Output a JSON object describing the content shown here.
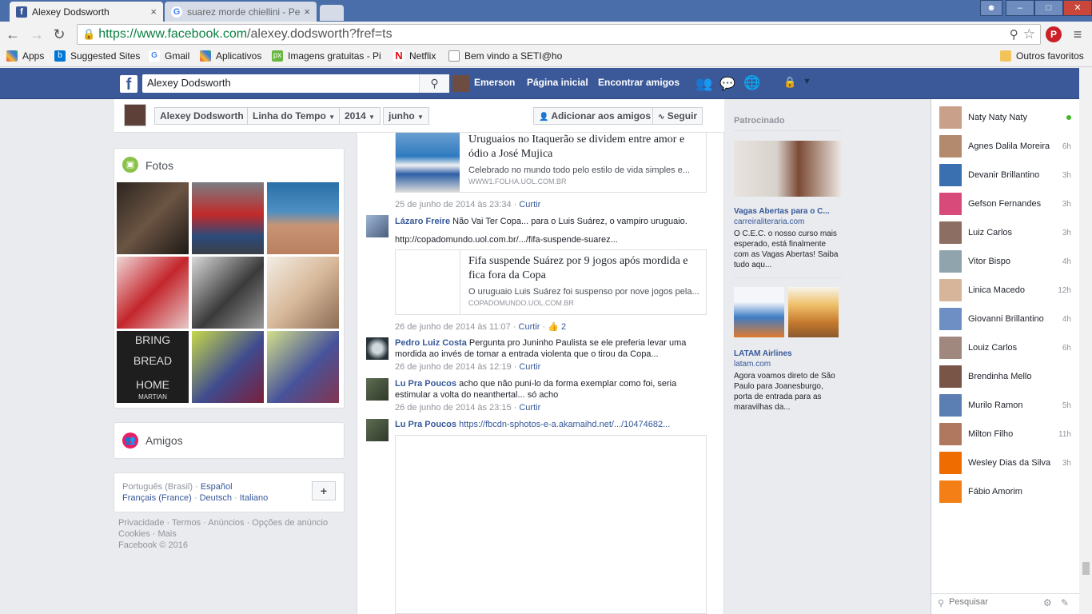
{
  "browser": {
    "tabs": [
      {
        "title": "Alexey Dodsworth",
        "close": "×"
      },
      {
        "title": "suarez morde chiellini - Pe",
        "close": "×"
      }
    ],
    "url": "https://www.facebook.com/alexey.dodsworth?fref=ts",
    "url_host": "https://www.facebook.com",
    "url_path": "/alexey.dodsworth?fref=ts",
    "bookmarks": [
      "Apps",
      "Suggested Sites",
      "Gmail",
      "Aplicativos",
      "Imagens gratuitas - Pi",
      "Netflix",
      "Bem vindo a SETI@ho",
      "Outros favoritos"
    ]
  },
  "fb": {
    "search_value": "Alexey Dodsworth",
    "user": "Emerson",
    "nav": [
      "Página inicial",
      "Encontrar amigos"
    ]
  },
  "timeline": {
    "name": "Alexey Dodsworth",
    "section": "Linha do Tempo",
    "year": "2014",
    "month": "junho",
    "add_friend": "Adicionar aos amigos",
    "follow": "Seguir"
  },
  "left": {
    "photos_title": "Fotos",
    "photo_captions": [
      "BRING",
      "BREAD",
      "HOME",
      "MARTIAN"
    ],
    "friends_title": "Amigos",
    "langs": {
      "current": "Português (Brasil)",
      "sep": "·",
      "l1": "Español",
      "l2": "Français (France)",
      "l3": "Deutsch",
      "l4": "Italiano",
      "add": "+"
    },
    "footer": {
      "line1": "Privacidade · Termos · Anúncios · Opções de anúncio",
      "line2": "Cookies · Mais",
      "line3": "Facebook © 2016"
    }
  },
  "feed": {
    "article1": {
      "title": "Uruguaios no Itaquerão se dividem entre amor e ódio a José Mujica",
      "desc": "Celebrado no mundo todo pelo estilo de vida simples e...",
      "source": "WWW1.FOLHA.UOL.COM.BR"
    },
    "meta1": "25 de junho de 2014 às 23:34 · ",
    "curtir": "Curtir",
    "c1": {
      "name": "Lázaro Freire",
      "text": "Não Vai Ter Copa... para o Luis Suárez, o vampiro uruguaio.",
      "link": "http://copadomundo.uol.com.br/.../fifa-suspende-suarez..."
    },
    "article2": {
      "title": "Fifa suspende Suárez por 9 jogos após mordida e fica fora da Copa",
      "desc": "O uruguaio Luis Suárez foi suspenso por nove jogos pela...",
      "source": "COPADOMUNDO.UOL.COM.BR"
    },
    "meta2": "26 de junho de 2014 às 11:07 · ",
    "likes2": "2",
    "c2": {
      "name": "Pedro Luiz Costa",
      "text": "Pergunta pro Juninho Paulista se ele preferia levar uma mordida ao invés de tomar a entrada violenta que o tirou da Copa...",
      "meta": "26 de junho de 2014 às 12:19 · "
    },
    "c3": {
      "name": "Lu Pra Poucos",
      "text": "acho que não puni-lo da forma exemplar como foi, seria estimular a volta do neanthertal... só acho",
      "meta": "26 de junho de 2014 às 23:15 · "
    },
    "c4": {
      "name": "Lu Pra Poucos",
      "link": "https://fbcdn-sphotos-e-a.akamaihd.net/.../10474682..."
    }
  },
  "ads": {
    "title": "Patrocinado",
    "ad1": {
      "title": "Vagas Abertas para o C...",
      "domain": "carreiraliteraria.com",
      "text": "O C.E.C. o nosso curso mais esperado, está finalmente com as Vagas Abertas! Saiba tudo aqu..."
    },
    "ad2": {
      "title": "LATAM Airlines",
      "domain": "latam.com",
      "text": "Agora voamos direto de São Paulo para Joanesburgo, porta de entrada para as maravilhas da..."
    }
  },
  "chat": {
    "contacts": [
      {
        "name": "Naty Naty Naty",
        "time": ""
      },
      {
        "name": "Agnes Dalila Moreira",
        "time": "6h"
      },
      {
        "name": "Devanir Brillantino",
        "time": "3h"
      },
      {
        "name": "Gefson Fernandes",
        "time": "3h"
      },
      {
        "name": "Luiz Carlos",
        "time": "3h"
      },
      {
        "name": "Vitor Bispo",
        "time": "4h"
      },
      {
        "name": "Linica Macedo",
        "time": "12h"
      },
      {
        "name": "Giovanni Brillantino",
        "time": "4h"
      },
      {
        "name": "Louiz Carlos",
        "time": "6h"
      },
      {
        "name": "Brendinha Mello",
        "time": ""
      },
      {
        "name": "Murilo Ramon",
        "time": "5h"
      },
      {
        "name": "Milton Filho",
        "time": "11h"
      },
      {
        "name": "Wesley Dias da Silva",
        "time": "3h"
      },
      {
        "name": "Fábio Amorim",
        "time": ""
      }
    ],
    "search_placeholder": "Pesquisar"
  },
  "colors": {
    "fb_blue": "#3b5998",
    "link": "#365899",
    "online": "#42b72a"
  }
}
